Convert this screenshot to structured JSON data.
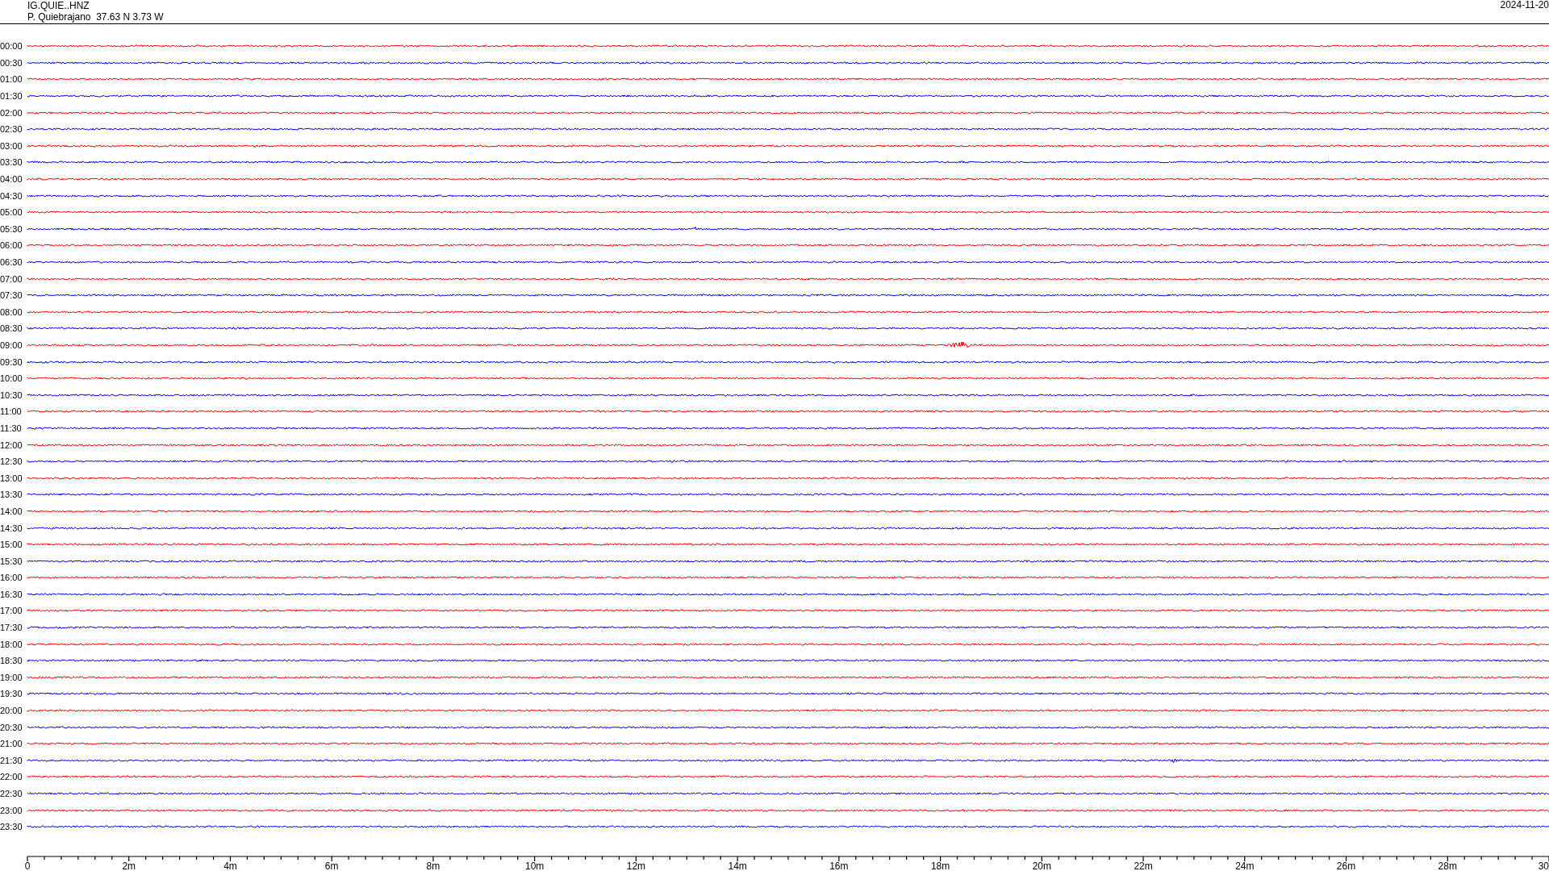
{
  "header": {
    "station": "IG.QUIE..HNZ",
    "location": "P. Quiebrajano  37.63 N 3.73 W",
    "date": "2024-11-20"
  },
  "rows": [
    {
      "label": "00:00",
      "color": "#ff0000"
    },
    {
      "label": "00:30",
      "color": "#0000ff"
    },
    {
      "label": "01:00",
      "color": "#ff0000"
    },
    {
      "label": "01:30",
      "color": "#0000ff"
    },
    {
      "label": "02:00",
      "color": "#ff0000"
    },
    {
      "label": "02:30",
      "color": "#0000ff"
    },
    {
      "label": "03:00",
      "color": "#ff0000"
    },
    {
      "label": "03:30",
      "color": "#0000ff"
    },
    {
      "label": "04:00",
      "color": "#ff0000"
    },
    {
      "label": "04:30",
      "color": "#0000ff"
    },
    {
      "label": "05:00",
      "color": "#ff0000"
    },
    {
      "label": "05:30",
      "color": "#0000ff"
    },
    {
      "label": "06:00",
      "color": "#ff0000"
    },
    {
      "label": "06:30",
      "color": "#0000ff"
    },
    {
      "label": "07:00",
      "color": "#ff0000"
    },
    {
      "label": "07:30",
      "color": "#0000ff"
    },
    {
      "label": "08:00",
      "color": "#ff0000"
    },
    {
      "label": "08:30",
      "color": "#0000ff"
    },
    {
      "label": "09:00",
      "color": "#ff0000"
    },
    {
      "label": "09:30",
      "color": "#0000ff"
    },
    {
      "label": "10:00",
      "color": "#ff0000"
    },
    {
      "label": "10:30",
      "color": "#0000ff"
    },
    {
      "label": "11:00",
      "color": "#ff0000"
    },
    {
      "label": "11:30",
      "color": "#0000ff"
    },
    {
      "label": "12:00",
      "color": "#ff0000"
    },
    {
      "label": "12:30",
      "color": "#0000ff"
    },
    {
      "label": "13:00",
      "color": "#ff0000"
    },
    {
      "label": "13:30",
      "color": "#0000ff"
    },
    {
      "label": "14:00",
      "color": "#ff0000"
    },
    {
      "label": "14:30",
      "color": "#0000ff"
    },
    {
      "label": "15:00",
      "color": "#ff0000"
    },
    {
      "label": "15:30",
      "color": "#0000ff"
    },
    {
      "label": "16:00",
      "color": "#ff0000"
    },
    {
      "label": "16:30",
      "color": "#0000ff"
    },
    {
      "label": "17:00",
      "color": "#ff0000"
    },
    {
      "label": "17:30",
      "color": "#0000ff"
    },
    {
      "label": "18:00",
      "color": "#ff0000"
    },
    {
      "label": "18:30",
      "color": "#0000ff"
    },
    {
      "label": "19:00",
      "color": "#ff0000"
    },
    {
      "label": "19:30",
      "color": "#0000ff"
    },
    {
      "label": "20:00",
      "color": "#ff0000"
    },
    {
      "label": "20:30",
      "color": "#0000ff"
    },
    {
      "label": "21:00",
      "color": "#ff0000"
    },
    {
      "label": "21:30",
      "color": "#0000ff"
    },
    {
      "label": "22:00",
      "color": "#ff0000"
    },
    {
      "label": "22:30",
      "color": "#0000ff"
    },
    {
      "label": "23:00",
      "color": "#ff0000"
    },
    {
      "label": "23:30",
      "color": "#0000ff"
    }
  ],
  "axis": {
    "ticks": [
      "0",
      "2m",
      "4m",
      "6m",
      "8m",
      "10m",
      "12m",
      "14m",
      "16m",
      "18m",
      "20m",
      "22m",
      "24m",
      "26m",
      "28m",
      "30"
    ]
  }
}
